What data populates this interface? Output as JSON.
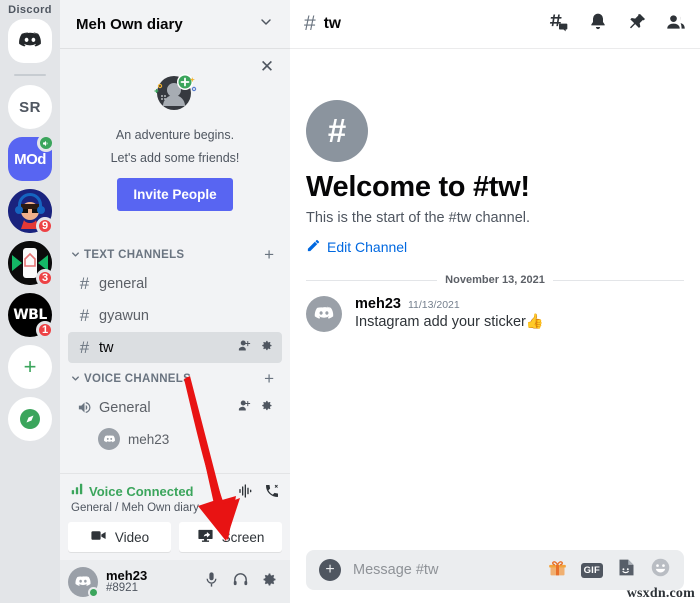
{
  "brand": {
    "wordmark": "Discord",
    "blurple": "#5865f2",
    "green": "#3ba55c",
    "red": "#ed4245"
  },
  "server_rail": {
    "items": [
      {
        "name": "home",
        "label": "",
        "icon": "discord-logo-icon",
        "badge": ""
      },
      {
        "name": "sr",
        "label": "SR",
        "icon": "",
        "badge": ""
      },
      {
        "name": "mod",
        "label": "MOd",
        "icon": "",
        "badge": "audio"
      },
      {
        "name": "avatar-dj",
        "label": "",
        "icon": "user-avatar-icon",
        "badge": "9"
      },
      {
        "name": "avatar-house",
        "label": "",
        "icon": "house-avatar-icon",
        "badge": "3"
      },
      {
        "name": "wbl",
        "label": "WBL",
        "icon": "",
        "badge": "1"
      },
      {
        "name": "add-server",
        "label": "+",
        "icon": "plus-icon",
        "badge": ""
      },
      {
        "name": "explore",
        "label": "",
        "icon": "compass-icon",
        "badge": ""
      }
    ]
  },
  "sidebar": {
    "server_name": "Meh Own diary",
    "invite_card": {
      "line1": "An adventure begins.",
      "line2": "Let's add some friends!",
      "button": "Invite People",
      "close": "✕"
    },
    "categories": [
      {
        "name": "TEXT CHANNELS",
        "channels": [
          {
            "name": "general",
            "type": "text",
            "active": false,
            "actions": false
          },
          {
            "name": "gyawun",
            "type": "text",
            "active": false,
            "actions": false
          },
          {
            "name": "tw",
            "type": "text",
            "active": true,
            "actions": true
          }
        ]
      },
      {
        "name": "VOICE CHANNELS",
        "channels": [
          {
            "name": "General",
            "type": "voice",
            "active": false,
            "actions": true
          }
        ],
        "voice_members": [
          {
            "name": "meh23"
          }
        ]
      }
    ],
    "voice_panel": {
      "status": "Voice Connected",
      "location": "General / Meh Own diary",
      "video_button": "Video",
      "screen_button": "Screen"
    },
    "user_panel": {
      "username": "meh23",
      "discriminator": "#8921"
    }
  },
  "main": {
    "header": {
      "channel": "tw",
      "hash": "#"
    },
    "welcome": {
      "title": "Welcome to #tw!",
      "subtitle": "This is the start of the #tw channel.",
      "edit_link": "Edit Channel"
    },
    "date_divider": "November 13, 2021",
    "messages": [
      {
        "author": "meh23",
        "timestamp": "11/13/2021",
        "text": "Instagram add your sticker",
        "emoji": "👍"
      }
    ],
    "composer": {
      "placeholder": "Message #tw",
      "plus": "+",
      "gif_label": "GIF"
    }
  },
  "watermark": "wsxdn.com"
}
